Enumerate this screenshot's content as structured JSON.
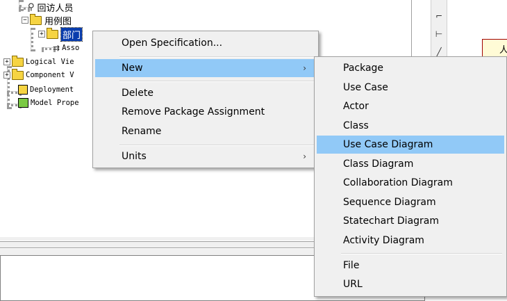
{
  "tree": {
    "items": [
      {
        "label": "回访人员",
        "icon": "actor-icon"
      },
      {
        "label": "用例图",
        "icon": "folder-icon",
        "expander": "−"
      },
      {
        "label": "部门",
        "icon": "folder-icon",
        "expander": "+",
        "selected": true
      },
      {
        "label": "Asso",
        "icon": "association-icon"
      },
      {
        "label": "Logical Vie",
        "icon": "folder-icon",
        "expander": "+"
      },
      {
        "label": "Component V",
        "icon": "folder-icon",
        "expander": "+"
      },
      {
        "label": "Deployment",
        "icon": "deployment-icon"
      },
      {
        "label": "Model Prope",
        "icon": "model-properties-icon"
      }
    ]
  },
  "toolbar": {
    "tools": [
      {
        "icon": "anchor-note-icon",
        "glyph": "⌐"
      },
      {
        "icon": "association-tool-icon",
        "glyph": "⊢"
      },
      {
        "icon": "dependency-tool-icon",
        "glyph": "╱"
      }
    ]
  },
  "diagram": {
    "partial_label": "人"
  },
  "context_menu": {
    "items": [
      {
        "label": "Open Specification...",
        "submenu": false
      },
      {
        "label": "New",
        "submenu": true,
        "highlighted": true
      },
      {
        "label": "Delete",
        "submenu": false
      },
      {
        "label": "Remove Package Assignment",
        "submenu": false
      },
      {
        "label": "Rename",
        "submenu": false
      },
      {
        "label": "Units",
        "submenu": true
      }
    ],
    "submenu_arrow": "›"
  },
  "new_submenu": {
    "items": [
      {
        "label": "Package"
      },
      {
        "label": "Use Case"
      },
      {
        "label": "Actor"
      },
      {
        "label": "Class"
      },
      {
        "label": "Use Case Diagram",
        "highlighted": true
      },
      {
        "label": "Class Diagram"
      },
      {
        "label": "Collaboration Diagram"
      },
      {
        "label": "Sequence Diagram"
      },
      {
        "label": "Statechart Diagram"
      },
      {
        "label": "Activity Diagram"
      },
      {
        "label": "File"
      },
      {
        "label": "URL"
      }
    ]
  },
  "colors": {
    "menu_highlight": "#91c9f7",
    "selection": "#0a3dad",
    "folder": "#f6d442"
  }
}
